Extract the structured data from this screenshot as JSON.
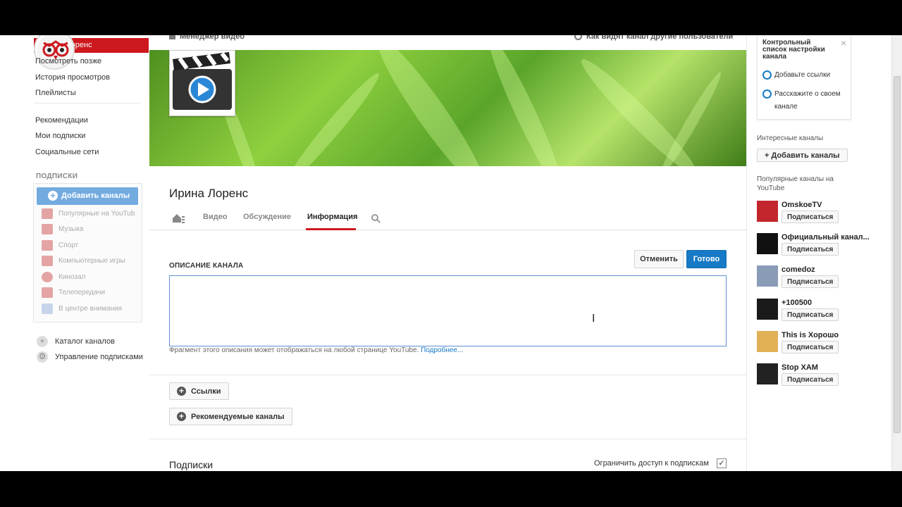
{
  "sidebar": {
    "active_item": "Ирина Лоренс",
    "links": [
      "Посмотреть позже",
      "История просмотров",
      "Плейлисты"
    ],
    "links2": [
      "Рекомендации",
      "Мои подписки",
      "Социальные сети"
    ],
    "subs_heading": "ПОДПИСКИ",
    "add_channels": "Добавить каналы",
    "sub_items": [
      "Популярные на YouTub",
      "Музыка",
      "Спорт",
      "Компьютерные игры",
      "Кинозал",
      "Телепередачи",
      "В центре внимания"
    ],
    "footer_links": [
      "Каталог каналов",
      "Управление подписками"
    ]
  },
  "main": {
    "video_manager": "Менеджер видео",
    "view_as": "Как видят канал другие пользователи",
    "channel_name": "Ирина Лоренс",
    "tabs": [
      "Видео",
      "Обсуждение",
      "Информация"
    ],
    "description_label": "ОПИСАНИЕ КАНАЛА",
    "cancel": "Отменить",
    "done": "Готово",
    "hint": "Фрагмент этого описания может отображаться на любой странице YouTube.",
    "hint_link": "Подробнее...",
    "links_btn": "Ссылки",
    "featured_btn": "Рекомендуемые каналы",
    "subscriptions_title": "Подписки",
    "restrict_label": "Ограничить доступ к подпискам",
    "restrict_checked": true
  },
  "right": {
    "checklist_title": "Контрольный список настройки канала",
    "checklist_items": [
      "Добавьте ссылки",
      "Расскажите о своем канале"
    ],
    "interesting_heading": "Интересные каналы",
    "add_channels": "+ Добавить каналы",
    "popular_heading": "Популярные каналы на YouTube",
    "subscribe_label": "Подписаться",
    "channels": [
      {
        "name": "OmskoeTV",
        "color": "#c2262c"
      },
      {
        "name": "Официальный канал...",
        "color": "#111111"
      },
      {
        "name": "comedoz",
        "color": "#8a9bb5"
      },
      {
        "name": "+100500",
        "color": "#1a1a1a"
      },
      {
        "name": "This is Хорошо",
        "color": "#e0b057"
      },
      {
        "name": "Stop XAM",
        "color": "#222222"
      }
    ]
  },
  "colors": {
    "accent_red": "#cc181e",
    "accent_blue": "#167ac6"
  }
}
